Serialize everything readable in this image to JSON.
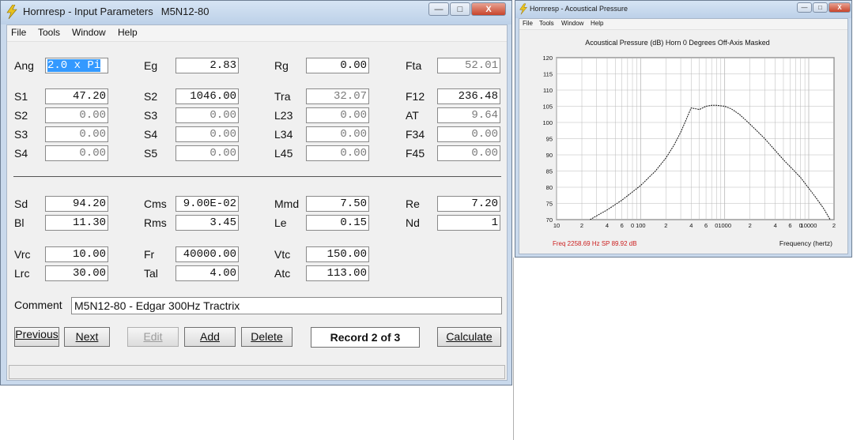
{
  "main_window": {
    "title": "Hornresp - Input Parameters",
    "record_name": "M5N12-80",
    "menu": [
      "File",
      "Tools",
      "Window",
      "Help"
    ],
    "title_buttons": {
      "minimize": "—",
      "maximize": "□",
      "close": "X"
    },
    "params": {
      "ang": {
        "label": "Ang",
        "value": "2.0 x Pi"
      },
      "eg": {
        "label": "Eg",
        "value": "2.83"
      },
      "rg": {
        "label": "Rg",
        "value": "0.00"
      },
      "fta": {
        "label": "Fta",
        "value": "52.01"
      },
      "s1a": {
        "label": "S1",
        "value": "47.20"
      },
      "s2a": {
        "label": "S2",
        "value": "1046.00"
      },
      "tra": {
        "label": "Tra",
        "value": "32.07"
      },
      "f12": {
        "label": "F12",
        "value": "236.48"
      },
      "s2b": {
        "label": "S2",
        "value": "0.00"
      },
      "s3a": {
        "label": "S3",
        "value": "0.00"
      },
      "l23": {
        "label": "L23",
        "value": "0.00"
      },
      "at": {
        "label": "AT",
        "value": "9.64"
      },
      "s3b": {
        "label": "S3",
        "value": "0.00"
      },
      "s4a": {
        "label": "S4",
        "value": "0.00"
      },
      "l34": {
        "label": "L34",
        "value": "0.00"
      },
      "f34": {
        "label": "F34",
        "value": "0.00"
      },
      "s4b": {
        "label": "S4",
        "value": "0.00"
      },
      "s5": {
        "label": "S5",
        "value": "0.00"
      },
      "l45": {
        "label": "L45",
        "value": "0.00"
      },
      "f45": {
        "label": "F45",
        "value": "0.00"
      },
      "sd": {
        "label": "Sd",
        "value": "94.20"
      },
      "cms": {
        "label": "Cms",
        "value": "9.00E-02"
      },
      "mmd": {
        "label": "Mmd",
        "value": "7.50"
      },
      "re": {
        "label": "Re",
        "value": "7.20"
      },
      "bl": {
        "label": "Bl",
        "value": "11.30"
      },
      "rms": {
        "label": "Rms",
        "value": "3.45"
      },
      "le": {
        "label": "Le",
        "value": "0.15"
      },
      "nd": {
        "label": "Nd",
        "value": "1"
      },
      "vrc": {
        "label": "Vrc",
        "value": "10.00"
      },
      "fr": {
        "label": "Fr",
        "value": "40000.00"
      },
      "vtc": {
        "label": "Vtc",
        "value": "150.00"
      },
      "lrc": {
        "label": "Lrc",
        "value": "30.00"
      },
      "tal": {
        "label": "Tal",
        "value": "4.00"
      },
      "atc": {
        "label": "Atc",
        "value": "113.00"
      }
    },
    "comment": {
      "label": "Comment",
      "value": "M5N12-80 - Edgar 300Hz Tractrix"
    },
    "buttons": {
      "previous": "Previous",
      "next": "Next",
      "edit": "Edit",
      "add": "Add",
      "delete": "Delete",
      "record": "Record 2 of 3",
      "calculate": "Calculate"
    }
  },
  "chart_window": {
    "title": "Hornresp - Acoustical Pressure",
    "menu": [
      "File",
      "Tools",
      "Window",
      "Help"
    ],
    "title_buttons": {
      "minimize": "—",
      "maximize": "□",
      "close": "X"
    },
    "footer": {
      "readout": "Freq 2258.69 Hz   SP  89.92 dB",
      "xlabel": "Frequency (hertz)"
    },
    "colors": {
      "readout": "#cc2020",
      "curve": "#111111",
      "grid": "#b8b8b8"
    }
  },
  "chart_data": {
    "type": "line",
    "title": "Acoustical Pressure (dB)   Horn   0 Degrees Off-Axis   Masked",
    "xlabel": "Frequency (hertz)",
    "ylabel": "",
    "x_scale": "log",
    "xlim": [
      10,
      20000
    ],
    "ylim": [
      70,
      120
    ],
    "y_ticks": [
      70,
      75,
      80,
      85,
      90,
      95,
      100,
      105,
      110,
      115,
      120
    ],
    "x_tick_labels": [
      {
        "x": 10,
        "label": "10"
      },
      {
        "x": 20,
        "label": "2"
      },
      {
        "x": 40,
        "label": "4"
      },
      {
        "x": 60,
        "label": "6"
      },
      {
        "x": 80,
        "label": "0"
      },
      {
        "x": 100,
        "label": "100"
      },
      {
        "x": 200,
        "label": "2"
      },
      {
        "x": 400,
        "label": "4"
      },
      {
        "x": 600,
        "label": "6"
      },
      {
        "x": 800,
        "label": "0"
      },
      {
        "x": 1000,
        "label": "1000"
      },
      {
        "x": 2000,
        "label": "2"
      },
      {
        "x": 4000,
        "label": "4"
      },
      {
        "x": 6000,
        "label": "6"
      },
      {
        "x": 8000,
        "label": "0"
      },
      {
        "x": 10000,
        "label": "10000"
      },
      {
        "x": 20000,
        "label": "2"
      }
    ],
    "grid": true,
    "series": [
      {
        "x": [
          25,
          40,
          60,
          100,
          150,
          200,
          250,
          300,
          350,
          400,
          500,
          600,
          700,
          800,
          1000,
          1200,
          1500,
          2000,
          3000,
          5000,
          8000,
          12000,
          15000,
          18000
        ],
        "y": [
          70,
          73,
          76,
          80.5,
          85,
          89,
          93,
          97,
          101,
          104.5,
          104,
          105,
          105.3,
          105.3,
          105,
          104.2,
          102.5,
          99.5,
          95,
          88.5,
          83,
          77,
          73.5,
          70
        ]
      }
    ]
  }
}
